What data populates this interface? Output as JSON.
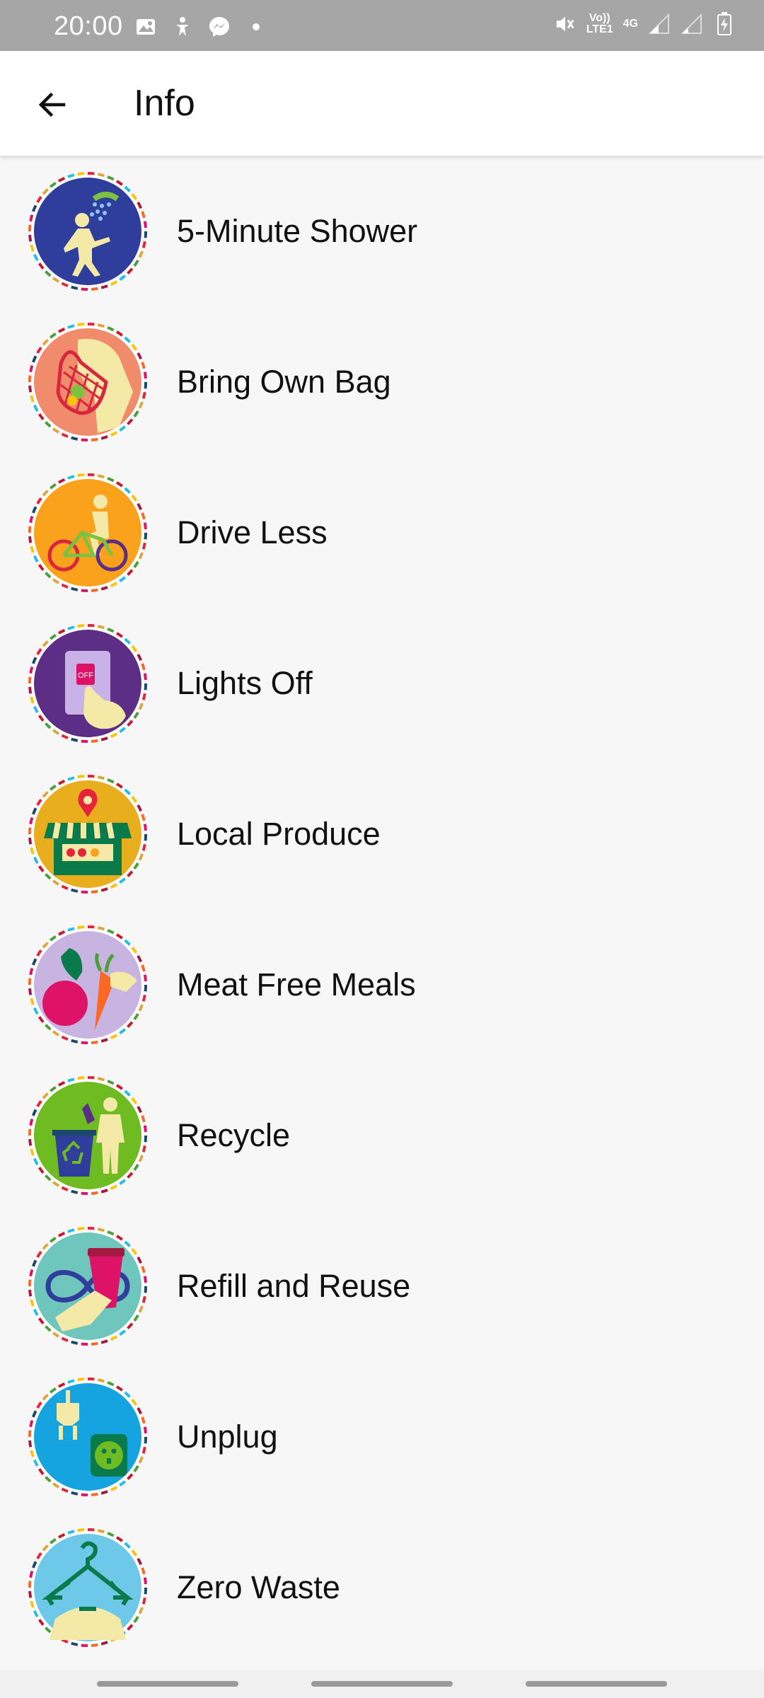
{
  "status_bar": {
    "time": "20:00",
    "left_icons": [
      "image-icon",
      "accessibility-icon",
      "messenger-icon",
      "dot-icon"
    ],
    "network_label_top": "Vo))",
    "network_label_bottom": "LTE1",
    "network_type": "4G"
  },
  "app_bar": {
    "title": "Info",
    "back_icon": "arrow-left-icon"
  },
  "items": [
    {
      "label": "5-Minute Shower",
      "icon": "shower-icon",
      "bg": "#2e3e9a"
    },
    {
      "label": "Bring Own Bag",
      "icon": "bag-icon",
      "bg": "#f08c6c"
    },
    {
      "label": "Drive Less",
      "icon": "bicycle-icon",
      "bg": "#fba21c"
    },
    {
      "label": "Lights Off",
      "icon": "light-switch-icon",
      "bg": "#5c2e86",
      "switch_text": "OFF"
    },
    {
      "label": "Local Produce",
      "icon": "market-stall-icon",
      "bg": "#e8ae1e"
    },
    {
      "label": "Meat Free Meals",
      "icon": "vegetables-icon",
      "bg": "#c8b4e0"
    },
    {
      "label": "Recycle",
      "icon": "recycle-bin-icon",
      "bg": "#6ebb22"
    },
    {
      "label": "Refill and Reuse",
      "icon": "reusable-cup-icon",
      "bg": "#6fc6bc"
    },
    {
      "label": "Unplug",
      "icon": "plug-icon",
      "bg": "#15a4df"
    },
    {
      "label": "Zero Waste",
      "icon": "hanger-icon",
      "bg": "#6ec8e8"
    }
  ],
  "colors": {
    "ring_segments": [
      "#e5243b",
      "#dda63a",
      "#4c9f38",
      "#c5192d",
      "#26bde2",
      "#fcc30b",
      "#a21942",
      "#fd6925",
      "#dd1367",
      "#19486a"
    ]
  }
}
